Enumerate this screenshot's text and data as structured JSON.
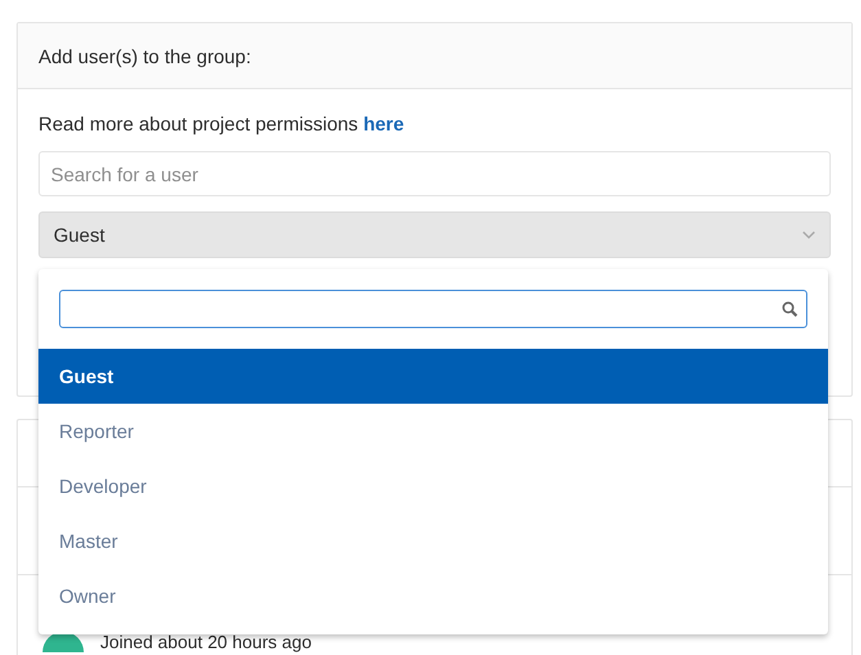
{
  "panel": {
    "title": "Add user(s) to the group:",
    "info": "Read more about project permissions",
    "info_link": "here",
    "search": {
      "placeholder": "Search for a user"
    },
    "role_select": {
      "value": "Guest"
    }
  },
  "dropdown": {
    "options": [
      {
        "label": "Guest",
        "selected": true
      },
      {
        "label": "Reporter",
        "selected": false
      },
      {
        "label": "Developer",
        "selected": false
      },
      {
        "label": "Master",
        "selected": false
      },
      {
        "label": "Owner",
        "selected": false
      }
    ]
  },
  "members": [
    {
      "joined": "Joined about 20 hours ago"
    }
  ]
}
